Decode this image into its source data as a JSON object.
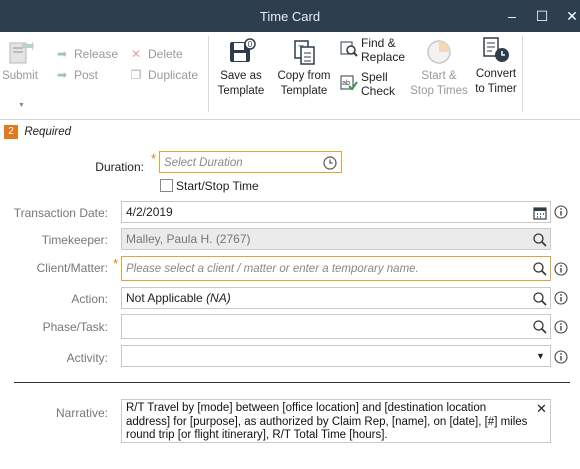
{
  "window": {
    "title": "Time Card",
    "minimize": "–",
    "maximize": "☐",
    "close": "✕"
  },
  "ribbon": {
    "submit": "Submit",
    "release": "Release",
    "post": "Post",
    "delete": "Delete",
    "duplicate": "Duplicate",
    "save_template": "Save as Template",
    "copy_template": "Copy from Template",
    "find_replace": "Find & Replace",
    "spell_check": "Spell Check",
    "start_stop": "Start & Stop Times",
    "convert_timer": "Convert to Timer"
  },
  "section": {
    "badge": "2",
    "label": "Required"
  },
  "form": {
    "duration": {
      "label": "Duration:",
      "placeholder": "Select Duration"
    },
    "start_stop_time": {
      "label": "Start/Stop Time",
      "checked": false
    },
    "transaction_date": {
      "label": "Transaction Date:",
      "value": "4/2/2019"
    },
    "timekeeper": {
      "label": "Timekeeper:",
      "value": "Malley, Paula H. (2767)"
    },
    "client_matter": {
      "label": "Client/Matter:",
      "placeholder": "Please select a client / matter or enter a temporary name."
    },
    "action": {
      "label": "Action:",
      "value": "Not Applicable",
      "code": "(NA)"
    },
    "phase_task": {
      "label": "Phase/Task:",
      "value": ""
    },
    "activity": {
      "label": "Activity:",
      "value": ""
    },
    "narrative": {
      "label": "Narrative:",
      "value": "R/T Travel by [mode] between [office location] and [destination location address] for [purpose], as authorized by Claim Rep, [name], on [date], [#] miles round trip [or flight itinerary], R/T Total Time [hours]."
    }
  },
  "required_mark": "*",
  "colors": {
    "titlebar": "#2d3e4e",
    "accent": "#e07a1c",
    "required_border": "#e0a43c"
  }
}
